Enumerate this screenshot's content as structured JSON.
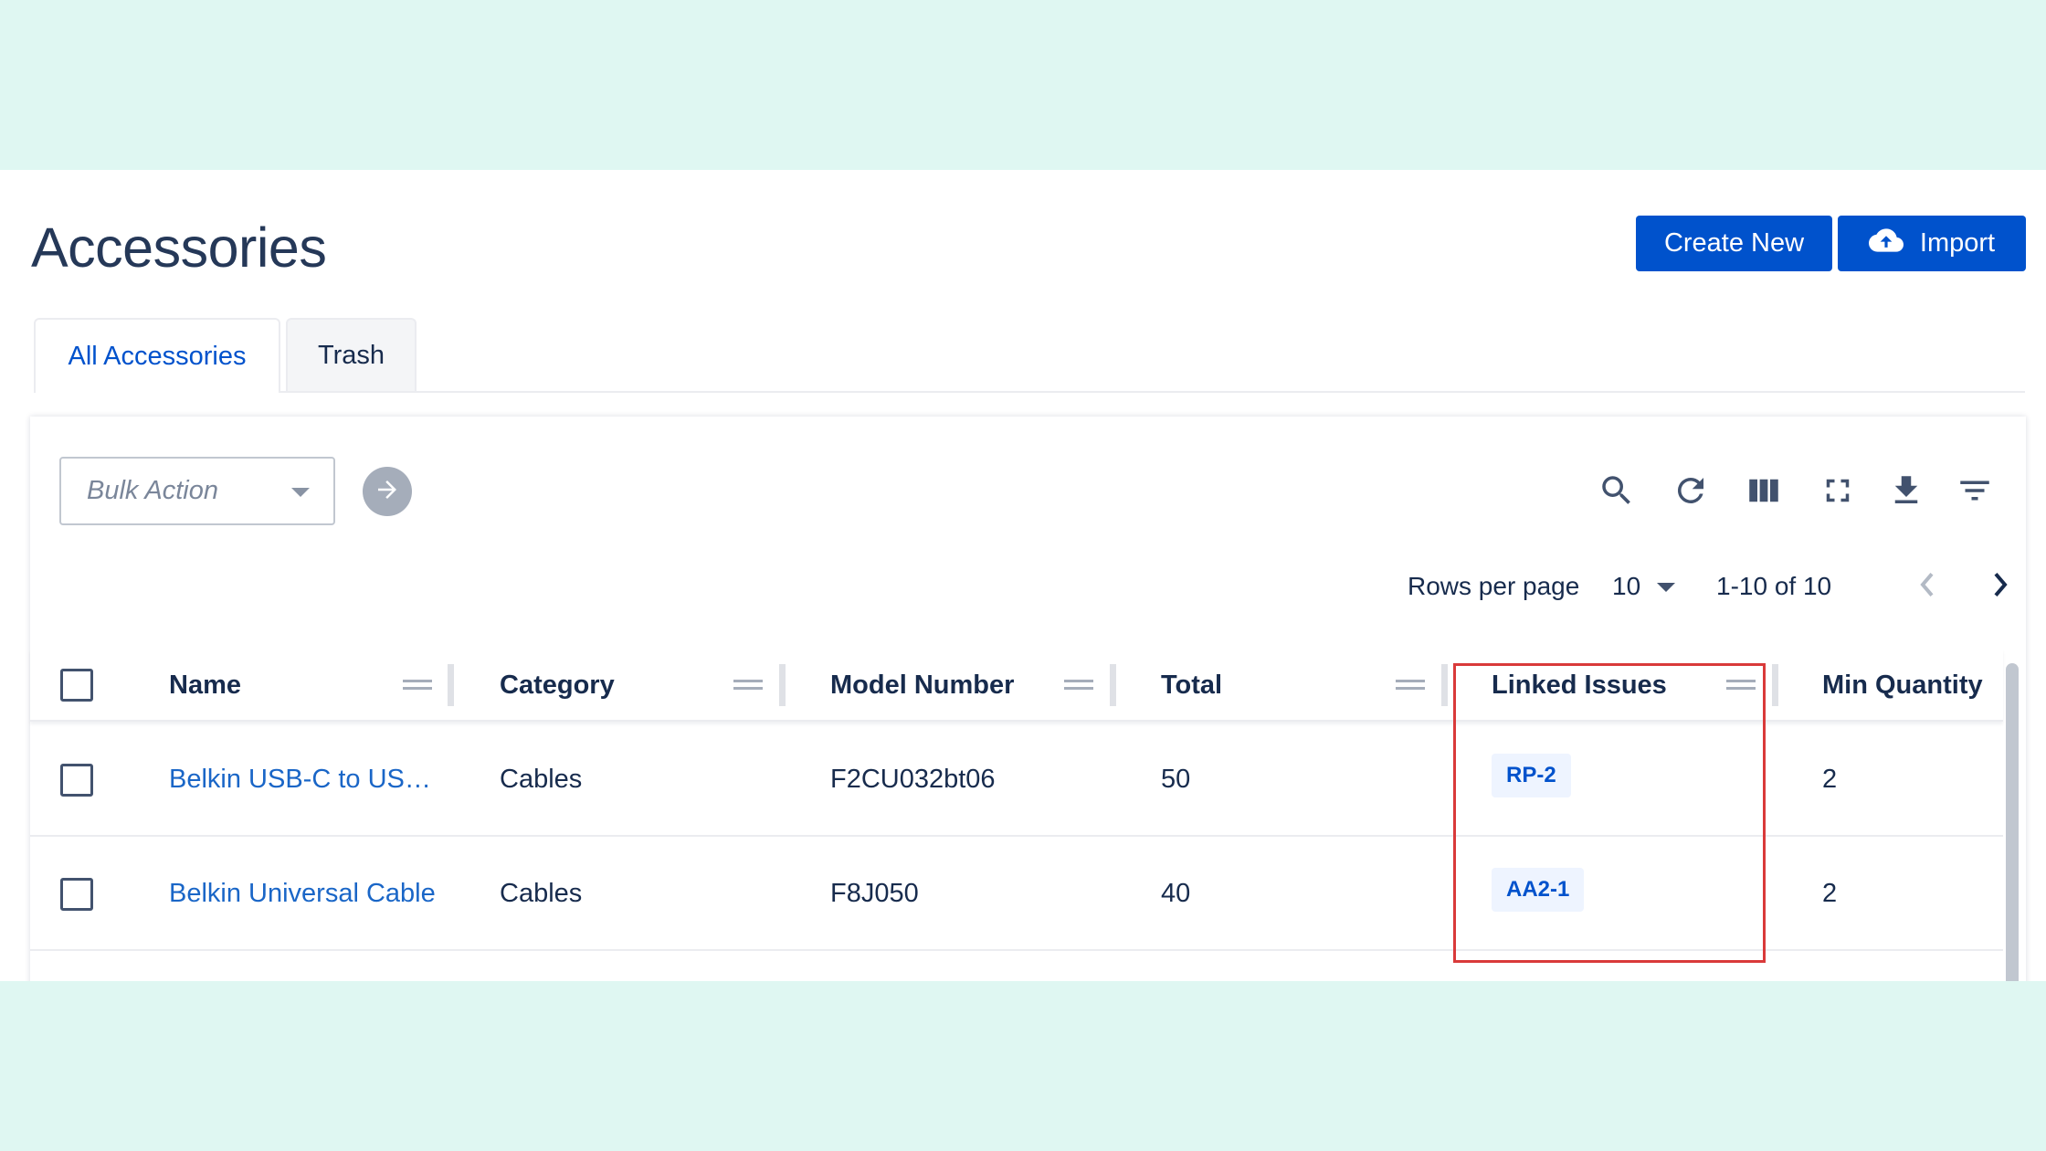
{
  "page": {
    "title": "Accessories",
    "create_button": "Create New",
    "import_button": "Import"
  },
  "tabs": [
    {
      "label": "All Accessories",
      "active": true
    },
    {
      "label": "Trash",
      "active": false
    }
  ],
  "toolbar": {
    "bulk_action_placeholder": "Bulk Action",
    "icons": [
      "search-icon",
      "refresh-icon",
      "columns-icon",
      "fullscreen-icon",
      "download-icon",
      "filter-icon"
    ]
  },
  "pagination": {
    "rows_per_page_label": "Rows per page",
    "rows_per_page_value": "10",
    "range": "1-10 of 10"
  },
  "table": {
    "columns": [
      "Name",
      "Category",
      "Model Number",
      "Total",
      "Linked Issues",
      "Min Quantity"
    ],
    "rows": [
      {
        "name": "Belkin USB-C to US…",
        "category": "Cables",
        "model": "F2CU032bt06",
        "total": "50",
        "issue": "RP-2",
        "min_qty": "2"
      },
      {
        "name": "Belkin Universal Cable",
        "category": "Cables",
        "model": "F8J050",
        "total": "40",
        "issue": "AA2-1",
        "min_qty": "2"
      }
    ]
  },
  "colors": {
    "brand": "#0052cc",
    "link": "#1a66c7",
    "highlight": "#d93a3a",
    "backdrop": "#dff7f2"
  }
}
